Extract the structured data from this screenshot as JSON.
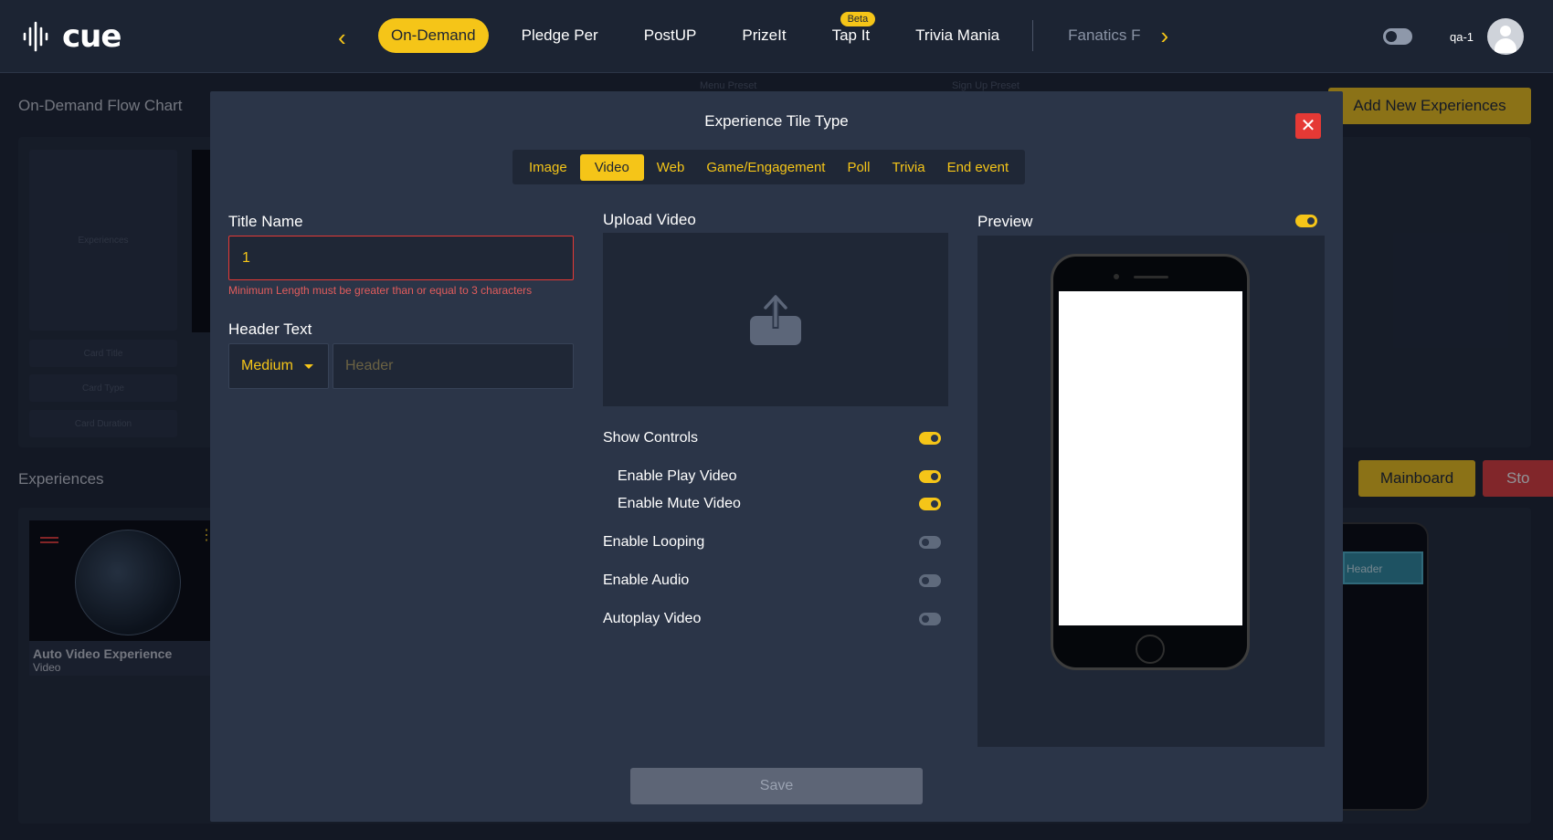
{
  "header": {
    "logo": "cue",
    "nav_items": [
      "On-Demand",
      "Pledge Per",
      "PostUP",
      "PrizeIt",
      "Tap It",
      "Trivia Mania",
      "Fanatics F"
    ],
    "beta_badge": "Beta",
    "user_name": "qa-1"
  },
  "background": {
    "flow_chart_title": "On-Demand Flow Chart",
    "menu_preset_label": "Menu Preset",
    "signup_preset_label": "Sign Up Preset",
    "add_new_button": "Add New Experiences",
    "experiences_title": "Experiences",
    "placeholder_experiences": "Experiences",
    "card_title_label": "Card Title",
    "card_type_label": "Card Type",
    "card_duration_label": "Card Duration",
    "mainboard_button": "Mainboard",
    "stop_button": "Sto",
    "card": {
      "title": "Auto Video Experience",
      "subtitle": "Video"
    },
    "phone_header": "Header"
  },
  "modal": {
    "title": "Experience Tile Type",
    "tabs": [
      "Image",
      "Video",
      "Web",
      "Game/Engagement",
      "Poll",
      "Trivia",
      "End event"
    ],
    "active_tab": "Video",
    "title_name_label": "Title Name",
    "title_name_value": "1",
    "title_error": "Minimum Length must be greater than or equal to 3 characters",
    "header_text_label": "Header Text",
    "header_size_value": "Medium",
    "header_placeholder": "Header",
    "upload_video_label": "Upload Video",
    "toggles": {
      "show_controls": {
        "label": "Show Controls",
        "on": true
      },
      "enable_play_video": {
        "label": "Enable Play Video",
        "on": true
      },
      "enable_mute_video": {
        "label": "Enable Mute Video",
        "on": true
      },
      "enable_looping": {
        "label": "Enable Looping",
        "on": false
      },
      "enable_audio": {
        "label": "Enable Audio",
        "on": false
      },
      "autoplay_video": {
        "label": "Autoplay Video",
        "on": false
      }
    },
    "preview_label": "Preview",
    "preview_toggle_on": true,
    "save_button": "Save"
  },
  "colors": {
    "accent": "#f5c518",
    "background": "#1b2230",
    "modal": "#2b3548",
    "danger": "#e53935"
  }
}
